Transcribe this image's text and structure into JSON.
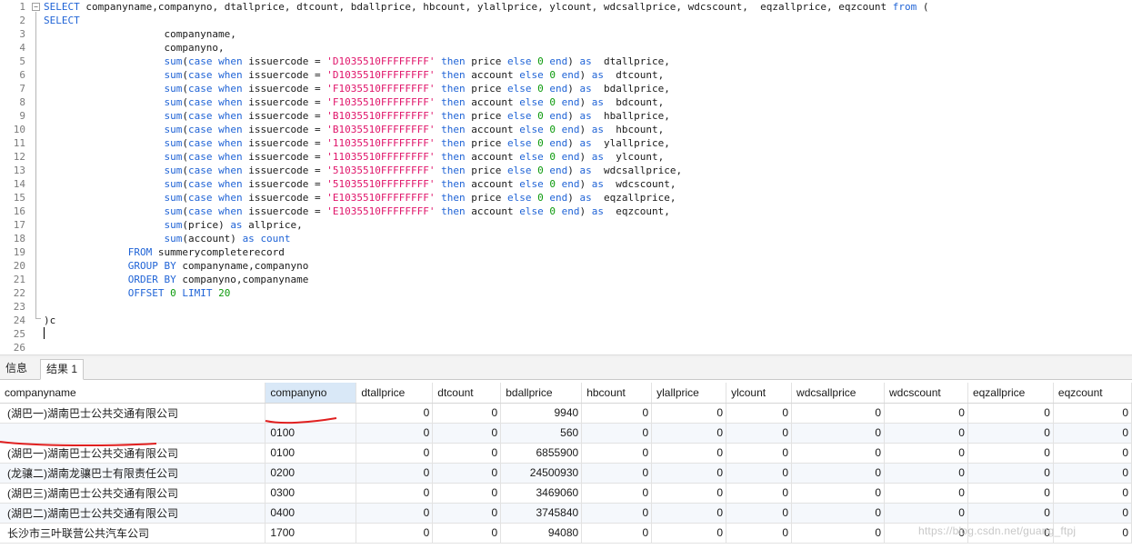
{
  "editor": {
    "lines": [
      "1",
      "2",
      "3",
      "4",
      "5",
      "6",
      "7",
      "8",
      "9",
      "10",
      "11",
      "12",
      "13",
      "14",
      "15",
      "16",
      "17",
      "18",
      "19",
      "20",
      "21",
      "22",
      "23",
      "24",
      "25",
      "26"
    ]
  },
  "tabs": {
    "messages": "信息",
    "result": "结果 1"
  },
  "grid": {
    "columns": [
      "companyname",
      "companyno",
      "dtallprice",
      "dtcount",
      "bdallprice",
      "hbcount",
      "ylallprice",
      "ylcount",
      "wdcsallprice",
      "wdcscount",
      "eqzallprice",
      "eqzcount"
    ],
    "rows": [
      [
        "(湖巴一)湖南巴士公共交通有限公司",
        "",
        "0",
        "0",
        "9940",
        "0",
        "0",
        "0",
        "0",
        "0",
        "0",
        "0"
      ],
      [
        "",
        "0100",
        "0",
        "0",
        "560",
        "0",
        "0",
        "0",
        "0",
        "0",
        "0",
        "0"
      ],
      [
        "(湖巴一)湖南巴士公共交通有限公司",
        "0100",
        "0",
        "0",
        "6855900",
        "0",
        "0",
        "0",
        "0",
        "0",
        "0",
        "0"
      ],
      [
        "(龙骧二)湖南龙骧巴士有限责任公司",
        "0200",
        "0",
        "0",
        "24500930",
        "0",
        "0",
        "0",
        "0",
        "0",
        "0",
        "0"
      ],
      [
        "(湖巴三)湖南巴士公共交通有限公司",
        "0300",
        "0",
        "0",
        "3469060",
        "0",
        "0",
        "0",
        "0",
        "0",
        "0",
        "0"
      ],
      [
        "(湖巴二)湖南巴士公共交通有限公司",
        "0400",
        "0",
        "0",
        "3745840",
        "0",
        "0",
        "0",
        "0",
        "0",
        "0",
        "0"
      ],
      [
        "长沙市三叶联营公共汽车公司",
        "1700",
        "0",
        "0",
        "94080",
        "0",
        "0",
        "0",
        "0",
        "0",
        "0",
        "0"
      ]
    ]
  },
  "watermark": "https://blog.csdn.net/guang_ftpj"
}
